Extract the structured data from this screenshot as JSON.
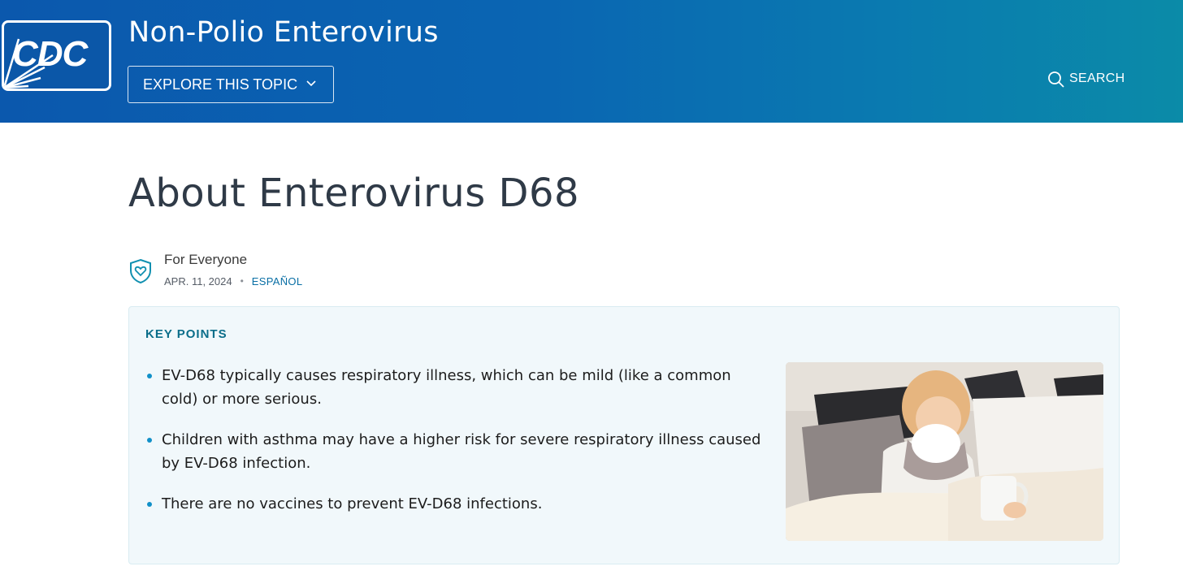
{
  "header": {
    "logo_text": "CDC",
    "site_title": "Non-Polio Enterovirus",
    "explore_label": "EXPLORE THIS TOPIC",
    "search_label": "SEARCH"
  },
  "article": {
    "title": "About Enterovirus D68",
    "audience": "For Everyone",
    "date": "APR. 11, 2024",
    "language_link": "ESPAÑOL"
  },
  "key_points": {
    "heading": "KEY POINTS",
    "items": [
      "EV-D68 typically causes respiratory illness, which can be mild (like a common cold) or more serious.",
      "Children with asthma may have a higher risk for severe respiratory illness caused by EV-D68 infection.",
      "There are no vaccines to prevent EV-D68 infections."
    ]
  },
  "colors": {
    "header_start": "#0b58ad",
    "header_end": "#0b8ba8",
    "title_text": "#2f3a47",
    "accent": "#0b6e8a",
    "bullet": "#1190c8",
    "link": "#0a6fa5",
    "keybox_bg": "#f1f8fb"
  },
  "icons": {
    "logo": "cdc-logo",
    "explore": "chevron-down-icon",
    "search": "search-icon",
    "audience": "shield-heart-icon"
  }
}
